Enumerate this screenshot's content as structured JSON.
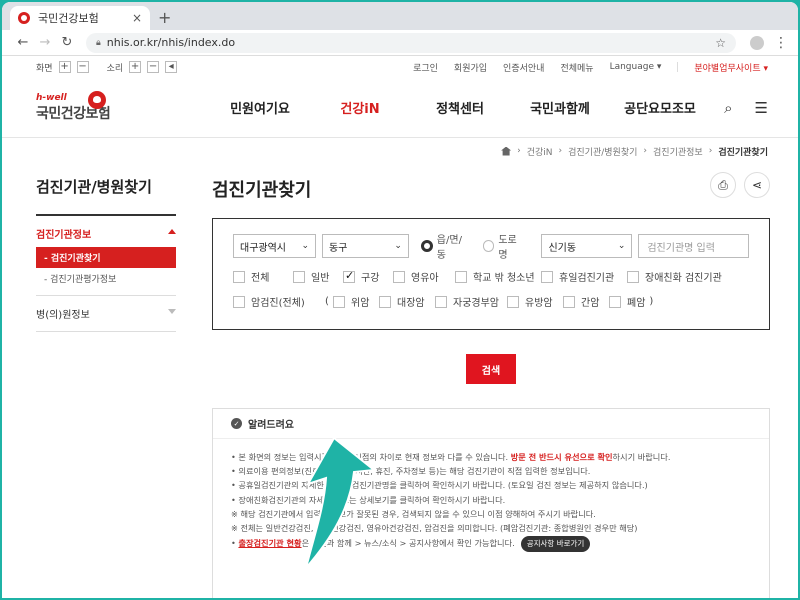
{
  "browser": {
    "tab_title": "국민건강보험",
    "tab_close": "×",
    "new_tab": "+",
    "url": "nhis.or.kr/nhis/index.do"
  },
  "util": {
    "screen_label": "화면",
    "sound_label": "소리",
    "plus": "+",
    "minus": "−",
    "links": [
      "로그인",
      "회원가입",
      "인증서안내",
      "전체메뉴",
      "Language ▾"
    ],
    "branch_link": "분야별업무사이트 ▾"
  },
  "header": {
    "logo_small": "h-well",
    "logo_text": "국민건강보험",
    "nav": [
      "민원여기요",
      "건강iN",
      "정책센터",
      "국민과함께",
      "공단요모조모"
    ]
  },
  "breadcrumb": [
    "건강iN",
    "검진기관/병원찾기",
    "검진기관정보",
    "검진기관찾기"
  ],
  "side": {
    "title": "검진기관/병원찾기",
    "group1": "검진기관정보",
    "items": [
      "검진기관찾기",
      "검진기관평가정보"
    ],
    "group2": "병(의)원정보"
  },
  "main": {
    "title": "검진기관찾기"
  },
  "search": {
    "city": "대구광역시",
    "district": "동구",
    "radio1": "읍/면/동",
    "radio2": "도로명",
    "dong": "신기동",
    "name_placeholder": "검진기관명 입력",
    "checks_row1": [
      "전체",
      "일반",
      "구강",
      "영유아",
      "학교 밖 청소년",
      "휴일검진기관",
      "장애친화 검진기관"
    ],
    "cancer_label": "암검진(전체)",
    "open_paren": "(",
    "checks_row2": [
      "위암",
      "대장암",
      "자궁경부암",
      "유방암",
      "간암",
      "폐암"
    ],
    "close_paren": ")",
    "button": "검색"
  },
  "notice": {
    "title": "알려드려요",
    "line1_a": "• 본 화면의 정보는 입력시점과 검색시점의 차이로 현재 정보와 다를 수 있습니다.",
    "line1_b": "방문 전 반드시 유선으로 확인",
    "line1_c": "하시기 바랍니다.",
    "line2": "• 의료이용 편의정보(진료/점심/접수시간, 휴진, 주차정보 등)는 해당 검진기관이 직접 입력한 정보입니다.",
    "line3": "• 공휴일검진기관의 자세한 정보는 검진기관명을 클릭하여 확인하시기 바랍니다. (토요일 검진 정보는 제공하지 않습니다.)",
    "line4": "• 장애친화검진기관의 자세한 정보는 상세보기를 클릭하여 확인하시기 바랍니다.",
    "line5": "※ 해당 검진기관에서 입력한 정보가 잘못된 경우, 검색되지 않을 수 있으니 이점 양해하여 주시기 바랍니다.",
    "line6": "※ 전체는 일반건강검진, 구강건강검진, 영유아건강검진, 암검진을 의미합니다. (폐암검진기관: 종합병원인 경우만 해당)",
    "line7_link": "출장검진기관 현황",
    "line7_text": "은 국민과 함께 > 뉴스/소식 > 공지사항에서 확인 가능합니다.",
    "line7_button": "공지사항 바로가기"
  },
  "colors": {
    "accent": "#d6201f",
    "frame": "#1fb3a6",
    "arrow": "#1fb3a6"
  }
}
